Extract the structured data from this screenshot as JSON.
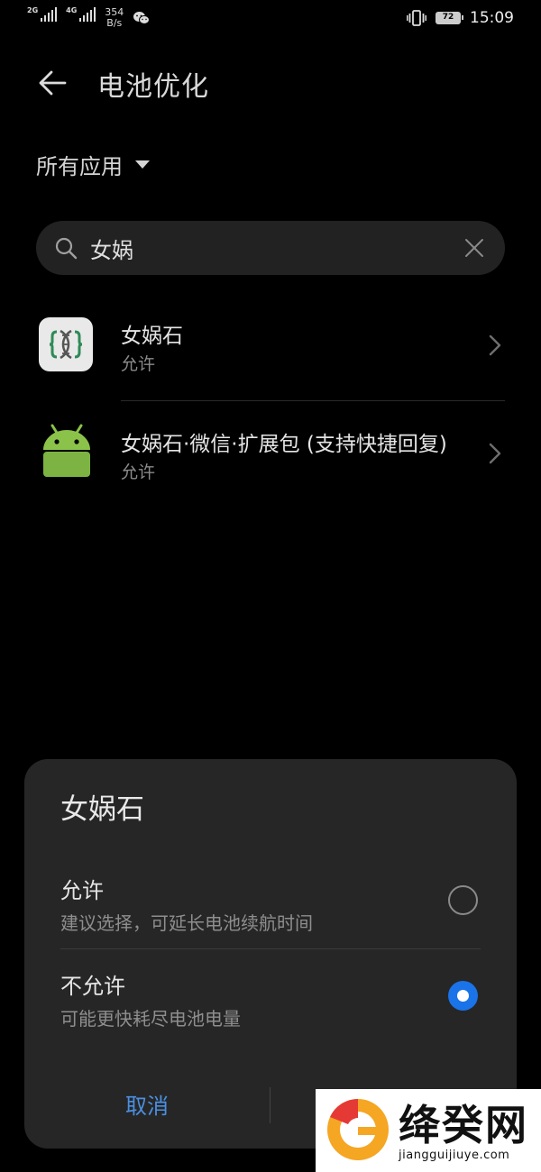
{
  "status_bar": {
    "sim1": "2G",
    "sim2": "4G",
    "net_speed_value": "354",
    "net_speed_unit": "B/s",
    "battery_level": "72",
    "time": "15:09",
    "icons": [
      "signal-2g-icon",
      "signal-4g-icon",
      "wechat-icon",
      "vibrate-icon",
      "battery-icon"
    ]
  },
  "header": {
    "title": "电池优化",
    "back_icon": "arrow-left-icon"
  },
  "filter": {
    "label": "所有应用"
  },
  "search": {
    "value": "女娲",
    "icons": [
      "search-icon",
      "clear-icon"
    ]
  },
  "apps": [
    {
      "name": "女娲石",
      "status": "允许",
      "icon": "dna-app-icon"
    },
    {
      "name": "女娲石·微信·扩展包 (支持快捷回复)",
      "status": "允许",
      "icon": "android-icon"
    }
  ],
  "dialog": {
    "title": "女娲石",
    "options": [
      {
        "label": "允许",
        "description": "建议选择，可延长电池续航时间",
        "selected": false
      },
      {
        "label": "不允许",
        "description": "可能更快耗尽电池电量",
        "selected": true
      }
    ],
    "cancel_label": "取消"
  },
  "watermark": {
    "text": "绛癸网",
    "url": "jiangguijiuye.com"
  },
  "colors": {
    "background": "#000000",
    "accent": "#1a73e8",
    "button_text": "#4a90e2",
    "sheet": "#262626"
  }
}
